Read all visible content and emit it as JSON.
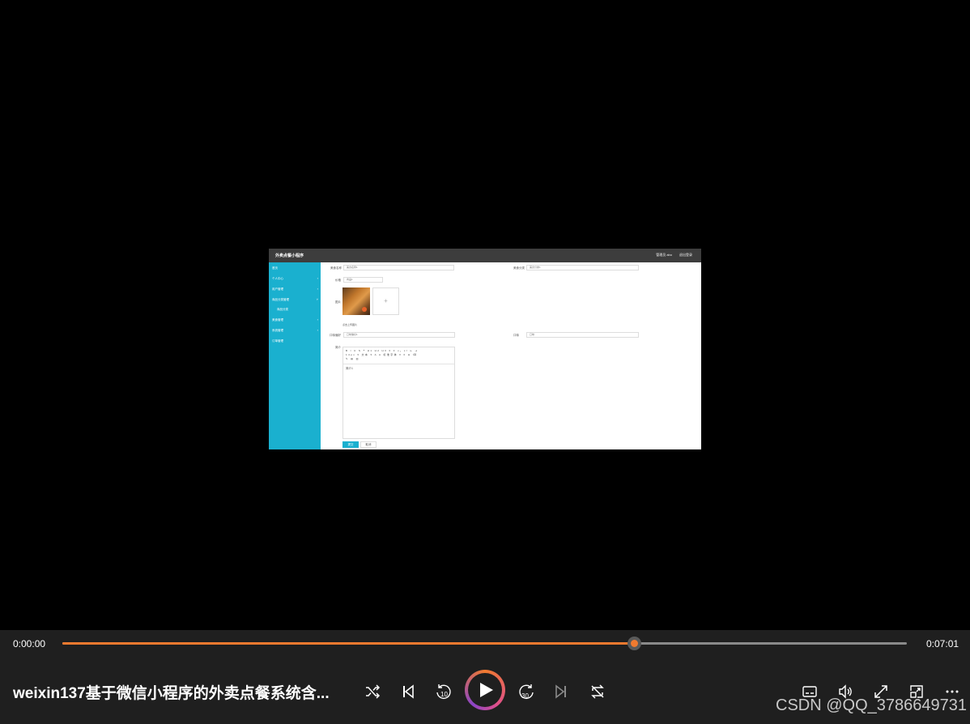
{
  "video": {
    "app_title": "外卖点餐小程序",
    "header_user": "管理员 abo",
    "header_logout": "退出登录",
    "sidebar": [
      {
        "label": "首页",
        "has_arrow": false
      },
      {
        "label": "个人中心",
        "has_arrow": true
      },
      {
        "label": "用户管理",
        "has_arrow": true
      },
      {
        "label": "商品分类管理",
        "has_arrow": true
      },
      {
        "label": "商品分类",
        "has_arrow": false,
        "sub": true
      },
      {
        "label": "美食管理",
        "has_arrow": true
      },
      {
        "label": "系统管理",
        "has_arrow": true
      },
      {
        "label": "订单管理",
        "has_arrow": false
      }
    ],
    "form": {
      "food_name_label": "美食名称",
      "food_name_value": "美食名称1",
      "food_category_label": "美食分类",
      "food_category_value": "美食分类1",
      "price_label": "价格",
      "price_value": "商品1",
      "image_label": "图片",
      "image_hint": "点击上传图片",
      "image_add": "+",
      "field_a_label": "口味偏好",
      "field_a_value": "口味偏好1",
      "field_b_label": "口味",
      "field_b_value": "口味",
      "detail_label": "简介",
      "editor_toolbar": [
        "B I U S ❝ H1 H2 H3 ≡ ≡ x₂ x² ⇤ ⇥",
        "14px ▾ 文本 ▾ A A 标准字体 ▾ ≡ ⊡ ⌫",
        "✎ ▤ ▥"
      ],
      "editor_text": "简介1",
      "submit_label": "提交",
      "cancel_label": "取消"
    }
  },
  "player": {
    "current_time": "0:00:00",
    "total_time": "0:07:01",
    "progress": 0.677,
    "title": "weixin137基于微信小程序的外卖点餐系统含...",
    "skip_back_seconds": "10",
    "skip_forward_seconds": "30",
    "watermark": "CSDN @QQ_3786649731"
  }
}
